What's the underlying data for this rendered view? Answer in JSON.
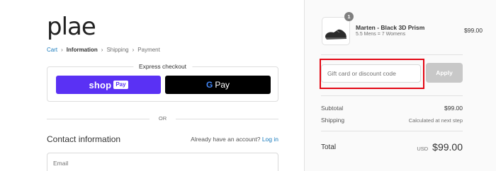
{
  "brand": {
    "logo_text": "plae"
  },
  "breadcrumb": {
    "items": [
      {
        "label": "Cart",
        "state": "link"
      },
      {
        "label": "Information",
        "state": "current"
      },
      {
        "label": "Shipping",
        "state": "upcoming"
      },
      {
        "label": "Payment",
        "state": "upcoming"
      }
    ],
    "separator": "›"
  },
  "express_checkout": {
    "title": "Express checkout",
    "shop_pay": {
      "shop": "shop",
      "pay": "Pay",
      "color": "#5a31f4"
    },
    "google_pay": {
      "g": "G",
      "label": "Pay",
      "color": "#000000"
    }
  },
  "divider_or": "OR",
  "contact": {
    "title": "Contact information",
    "have_account": "Already have an account?",
    "login_link": "Log in",
    "email_placeholder": "Email"
  },
  "order_summary": {
    "item": {
      "quantity_badge": "1",
      "name": "Marten - Black 3D Prism",
      "variant": "5.5 Mens = 7 Womens",
      "price": "$99.00",
      "thumbnail_icon": "shoe-thumbnail-icon"
    },
    "discount": {
      "placeholder": "Gift card or discount code",
      "apply_label": "Apply",
      "highlight_color": "#e30613"
    },
    "subtotal": {
      "label": "Subtotal",
      "value": "$99.00"
    },
    "shipping": {
      "label": "Shipping",
      "value": "Calculated at next step"
    },
    "total": {
      "label": "Total",
      "currency": "USD",
      "value": "$99.00"
    }
  },
  "colors": {
    "link": "#197bbd",
    "sidebar_bg": "#fafafa",
    "apply_disabled": "#c8c8c8"
  }
}
